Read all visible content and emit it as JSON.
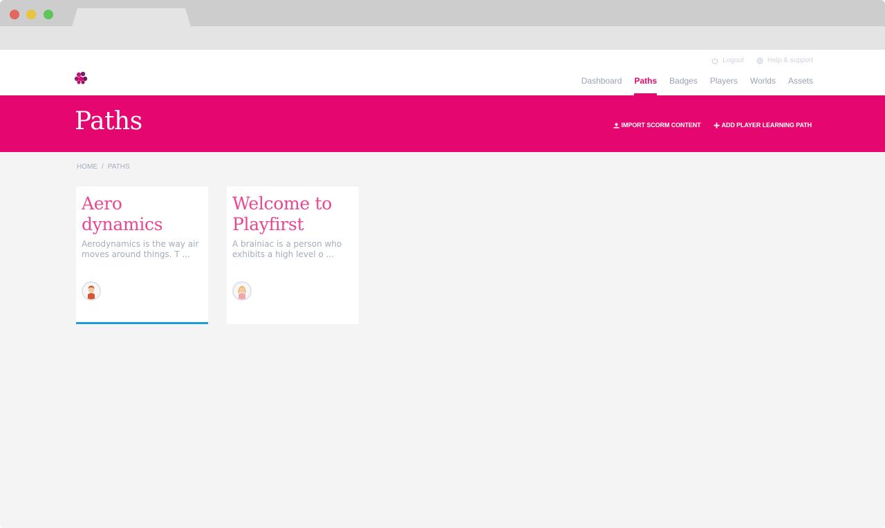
{
  "header": {
    "util_links": [
      {
        "label": "Logout",
        "icon": "power-icon"
      },
      {
        "label": "Help & support",
        "icon": "lifebuoy-icon"
      }
    ],
    "nav": [
      {
        "label": "Dashboard",
        "active": false
      },
      {
        "label": "Paths",
        "active": true
      },
      {
        "label": "Badges",
        "active": false
      },
      {
        "label": "Players",
        "active": false
      },
      {
        "label": "Worlds",
        "active": false
      },
      {
        "label": "Assets",
        "active": false
      }
    ]
  },
  "banner": {
    "title": "Paths",
    "actions": [
      {
        "label": "IMPORT SCORM CONTENT",
        "icon": "upload-icon"
      },
      {
        "label": "ADD PLAYER LEARNING PATH",
        "icon": "plus-icon"
      }
    ]
  },
  "breadcrumb": {
    "items": [
      "HOME",
      "PATHS"
    ],
    "separator": "/"
  },
  "cards": [
    {
      "title": "Aero dynamics",
      "desc": "Aerodynamics is the way air moves around things. T ...",
      "avatar": "avatar-boy-icon",
      "selected": true
    },
    {
      "title": "Welcome to Playfirst",
      "desc": "A brainiac is a person who exhibits a high level o ...",
      "avatar": "avatar-girl-icon",
      "selected": false
    }
  ],
  "colors": {
    "brand": "#e5076f",
    "card_title": "#e94791",
    "selected_border": "#1b9cd8",
    "muted_text": "#a3acb9",
    "background": "#f4f4f4"
  }
}
